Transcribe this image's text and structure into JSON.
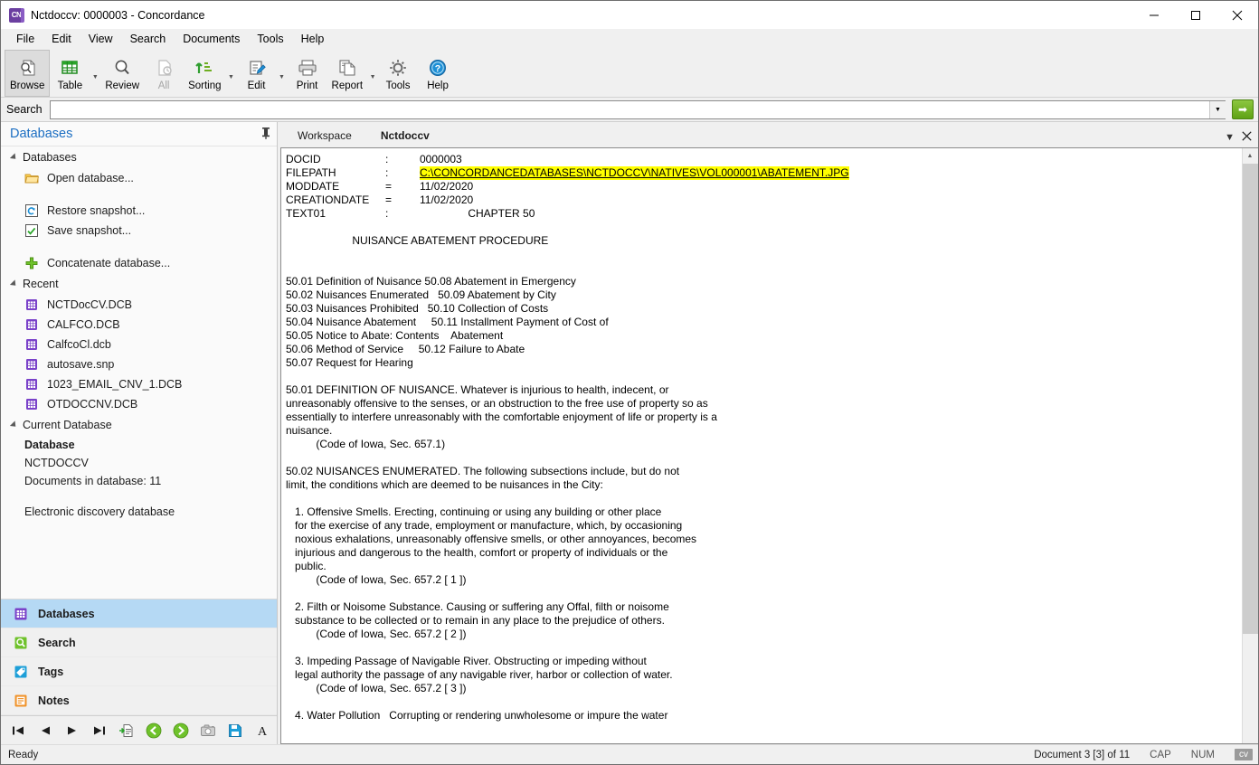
{
  "window": {
    "title": "Nctdoccv: 0000003 - Concordance",
    "icon_label": "CN",
    "minimize": "—",
    "maximize": "☐",
    "close": "✕"
  },
  "menubar": {
    "items": [
      {
        "label": "File"
      },
      {
        "label": "Edit"
      },
      {
        "label": "View"
      },
      {
        "label": "Search"
      },
      {
        "label": "Documents"
      },
      {
        "label": "Tools"
      },
      {
        "label": "Help"
      }
    ]
  },
  "ribbon": {
    "buttons": [
      {
        "label": "Browse",
        "icon": "browse-page-magnifier-icon",
        "selected": true,
        "disabled": false,
        "dropdown": false
      },
      {
        "label": "Table",
        "icon": "table-grid-icon",
        "selected": false,
        "disabled": false,
        "dropdown": true
      },
      {
        "label": "Review",
        "icon": "magnifier-icon",
        "selected": false,
        "disabled": false,
        "dropdown": false
      },
      {
        "label": "All",
        "icon": "all-documents-icon",
        "selected": false,
        "disabled": true,
        "dropdown": false
      },
      {
        "label": "Sorting",
        "icon": "sort-ascending-icon",
        "selected": false,
        "disabled": false,
        "dropdown": true
      },
      {
        "label": "Edit",
        "icon": "edit-pencil-icon",
        "selected": false,
        "disabled": false,
        "dropdown": true
      },
      {
        "label": "Print",
        "icon": "printer-icon",
        "selected": false,
        "disabled": false,
        "dropdown": false
      },
      {
        "label": "Report",
        "icon": "report-pages-icon",
        "selected": false,
        "disabled": false,
        "dropdown": true
      },
      {
        "label": "Tools",
        "icon": "gear-icon",
        "selected": false,
        "disabled": false,
        "dropdown": false
      },
      {
        "label": "Help",
        "icon": "help-question-icon",
        "selected": false,
        "disabled": false,
        "dropdown": false
      }
    ]
  },
  "search": {
    "label": "Search",
    "value": "",
    "placeholder": "",
    "dropdown_icon": "chevron-down-icon",
    "go_icon": "arrow-right-icon"
  },
  "sidebar": {
    "title": "Databases",
    "pin_icon": "pin-icon",
    "groups": [
      {
        "name": "Databases",
        "items": [
          {
            "label": "Open database...",
            "icon": "folder-icon"
          },
          {
            "label": "Restore snapshot...",
            "icon": "restore-snapshot-icon"
          },
          {
            "label": "Save snapshot...",
            "icon": "save-snapshot-icon"
          },
          {
            "label": "Concatenate database...",
            "icon": "plus-icon"
          }
        ]
      },
      {
        "name": "Recent",
        "items": [
          {
            "label": "NCTDocCV.DCB",
            "icon": "database-icon"
          },
          {
            "label": "CALFCO.DCB",
            "icon": "database-icon"
          },
          {
            "label": "CalfcoCl.dcb",
            "icon": "database-icon"
          },
          {
            "label": "autosave.snp",
            "icon": "database-icon"
          },
          {
            "label": "1023_EMAIL_CNV_1.DCB",
            "icon": "database-icon"
          },
          {
            "label": "OTDOCCNV.DCB",
            "icon": "database-icon"
          }
        ]
      }
    ],
    "current_database": {
      "group_name": "Current Database",
      "heading": "Database",
      "name": "NCTDOCCV",
      "doc_count_label": "Documents in database: 11",
      "description": "Electronic discovery database"
    },
    "nav": [
      {
        "label": "Databases",
        "icon": "databases-grid-icon",
        "active": true
      },
      {
        "label": "Search",
        "icon": "search-magnifier-icon",
        "active": false
      },
      {
        "label": "Tags",
        "icon": "tag-icon",
        "active": false
      },
      {
        "label": "Notes",
        "icon": "notes-icon",
        "active": false
      }
    ],
    "bottom_toolbar": [
      {
        "icon": "first-record-icon"
      },
      {
        "icon": "previous-record-icon"
      },
      {
        "icon": "next-record-icon"
      },
      {
        "icon": "last-record-icon"
      },
      {
        "icon": "add-document-icon"
      },
      {
        "icon": "back-green-icon"
      },
      {
        "icon": "forward-green-icon"
      },
      {
        "icon": "camera-snapshot-icon"
      },
      {
        "icon": "save-disk-icon"
      },
      {
        "icon": "font-icon"
      }
    ]
  },
  "tabs": {
    "items": [
      {
        "label": "Workspace",
        "active": false
      },
      {
        "label": "Nctdoccv",
        "active": true
      }
    ],
    "dropdown_icon": "chevron-down-icon",
    "close_icon": "close-icon"
  },
  "document": {
    "fields": [
      {
        "name": "DOCID",
        "sep": ":",
        "value": "0000003",
        "link": false
      },
      {
        "name": "FILEPATH",
        "sep": ":",
        "value": "C:\\CONCORDANCEDATABASES\\NCTDOCCV\\NATIVES\\VOL000001\\ABATEMENT.JPG",
        "link": true
      },
      {
        "name": "MODDATE",
        "sep": "=",
        "value": "11/02/2020",
        "link": false
      },
      {
        "name": "CREATIONDATE",
        "sep": "=",
        "value": "11/02/2020",
        "link": false
      },
      {
        "name": "TEXT01",
        "sep": ":",
        "value": "                CHAPTER 50",
        "link": false
      }
    ],
    "body": [
      "",
      "                      NUISANCE ABATEMENT PROCEDURE",
      "",
      "",
      "50.01 Definition of Nuisance 50.08 Abatement in Emergency",
      "50.02 Nuisances Enumerated   50.09 Abatement by City",
      "50.03 Nuisances Prohibited   50.10 Collection of Costs",
      "50.04 Nuisance Abatement     50.11 Installment Payment of Cost of",
      "50.05 Notice to Abate: Contents    Abatement",
      "50.06 Method of Service     50.12 Failure to Abate",
      "50.07 Request for Hearing",
      "",
      "50.01 DEFINITION OF NUISANCE. Whatever is injurious to health, indecent, or",
      "unreasonably offensive to the senses, or an obstruction to the free use of property so as",
      "essentially to interfere unreasonably with the comfortable enjoyment of life or property is a",
      "nuisance.",
      "          (Code of Iowa, Sec. 657.1)",
      "",
      "50.02 NUISANCES ENUMERATED. The following subsections include, but do not",
      "limit, the conditions which are deemed to be nuisances in the City:",
      "",
      "   1. Offensive Smells. Erecting, continuing or using any building or other place",
      "   for the exercise of any trade, employment or manufacture, which, by occasioning",
      "   noxious exhalations, unreasonably offensive smells, or other annoyances, becomes",
      "   injurious and dangerous to the health, comfort or property of individuals or the",
      "   public.",
      "          (Code of Iowa, Sec. 657.2 [ 1 ])",
      "",
      "   2. Filth or Noisome Substance. Causing or suffering any Offal, filth or noisome",
      "   substance to be collected or to remain in any place to the prejudice of others.",
      "          (Code of Iowa, Sec. 657.2 [ 2 ])",
      "",
      "   3. Impeding Passage of Navigable River. Obstructing or impeding without",
      "   legal authority the passage of any navigable river, harbor or collection of water.",
      "          (Code of Iowa, Sec. 657.2 [ 3 ])",
      "",
      "   4. Water Pollution   Corrupting or rendering unwholesome or impure the water"
    ],
    "scrollbar": {
      "up_icon": "scroll-up-icon",
      "down_icon": "scroll-down-icon"
    }
  },
  "statusbar": {
    "ready": "Ready",
    "document_position": "Document 3 [3] of 11",
    "cap": "CAP",
    "num": "NUM",
    "cv": "cv"
  },
  "colors": {
    "accent_blue": "#1b6ec2",
    "highlight_yellow": "#ffff00",
    "nav_active": "#b5d9f4",
    "green": "#6fae22",
    "purple": "#6b3fa0"
  }
}
